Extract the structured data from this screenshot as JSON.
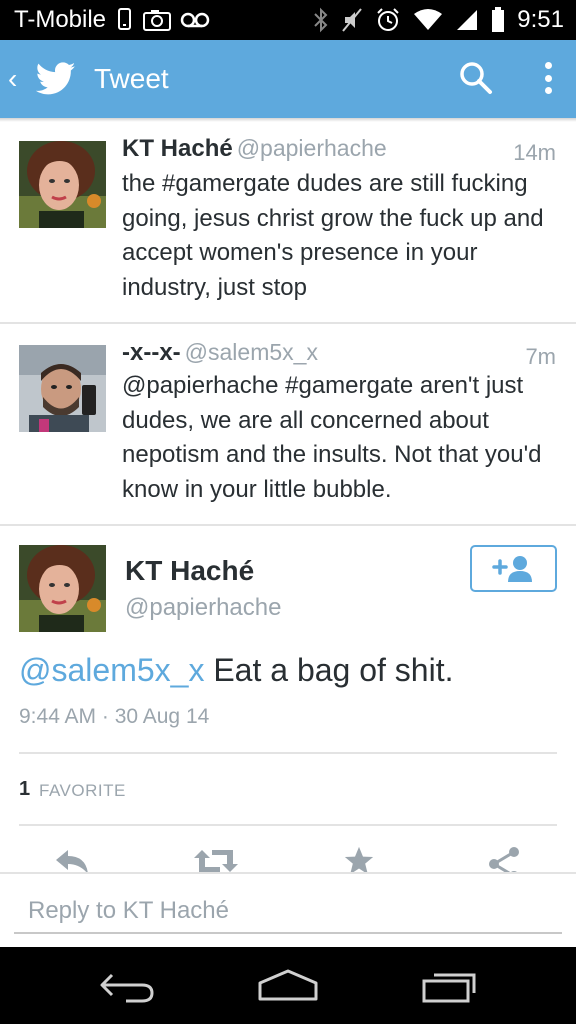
{
  "status_bar": {
    "carrier": "T-Mobile",
    "time": "9:51",
    "icons": [
      "phone-icon",
      "camera-icon",
      "voicemail-icon",
      "bluetooth-icon",
      "mute-icon",
      "alarm-icon",
      "wifi-icon",
      "signal-icon",
      "battery-icon"
    ]
  },
  "app_bar": {
    "title": "Tweet",
    "back_icon": "back-chevron-icon",
    "logo_icon": "twitter-bird-icon",
    "actions": [
      "search-icon",
      "more-options-icon"
    ]
  },
  "timeline": [
    {
      "name": "KT Haché",
      "handle": "@papierhache",
      "time": "14m",
      "text": "the #gamergate dudes are still fucking going, jesus christ grow the fuck up and accept women's presence in your industry, just stop"
    },
    {
      "name": "-x--x-",
      "handle": "@salem5x_x",
      "time": "7m",
      "text": "@papierhache #gamergate aren't just dudes, we are all concerned about nepotism and the insults. Not that you'd know in your little bubble."
    }
  ],
  "detail": {
    "name": "KT Haché",
    "handle": "@papierhache",
    "follow_icon": "add-user-icon",
    "mention": "@salem5x_x",
    "text": " Eat a bag of shit.",
    "timestamp": "9:44 AM · 30 Aug 14",
    "favorite_count": "1",
    "favorite_label": "FAVORITE",
    "actions": [
      "reply-icon",
      "retweet-icon",
      "favorite-star-icon",
      "share-icon"
    ]
  },
  "reply": {
    "placeholder": "Reply to KT Haché"
  },
  "nav_bar": [
    "nav-back-icon",
    "nav-home-icon",
    "nav-recents-icon"
  ],
  "colors": {
    "twitter_blue": "#5ea9dd",
    "text_dark": "#292f33",
    "text_gray": "#9ba5ad",
    "divider": "#e3e3e3"
  }
}
